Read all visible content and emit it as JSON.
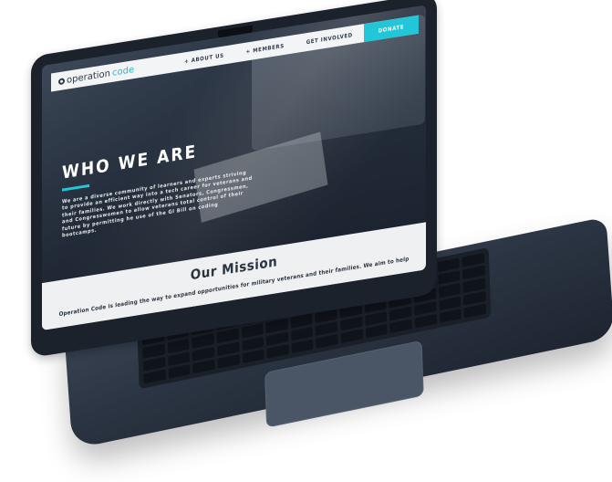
{
  "site": {
    "logo": {
      "prefix": "operation",
      "suffix": "code"
    },
    "nav": {
      "about_us": "+ ABOUT US",
      "members": "+ MEMBERS",
      "get_involved": "GET INVOLVED",
      "donate": "DONATE"
    },
    "hero": {
      "title": "WHO WE ARE",
      "body": "We are a diverse community of learners and experts striving to provide an efficient way into a tech career for veterans and their families. We work directly with Senators, Congressmen, and Congresswomen to allow veterans total control of their future by permitting he use of the GI Bill on coding bootcamps."
    },
    "mission": {
      "title": "Our Mission",
      "text": "Operation Code is leading the way to expand opportunities for military veterans and their families. We aim to help"
    }
  },
  "colors": {
    "accent": "#22c6d8",
    "navy": "#2f3b4b",
    "laptop": "#2b3442"
  }
}
